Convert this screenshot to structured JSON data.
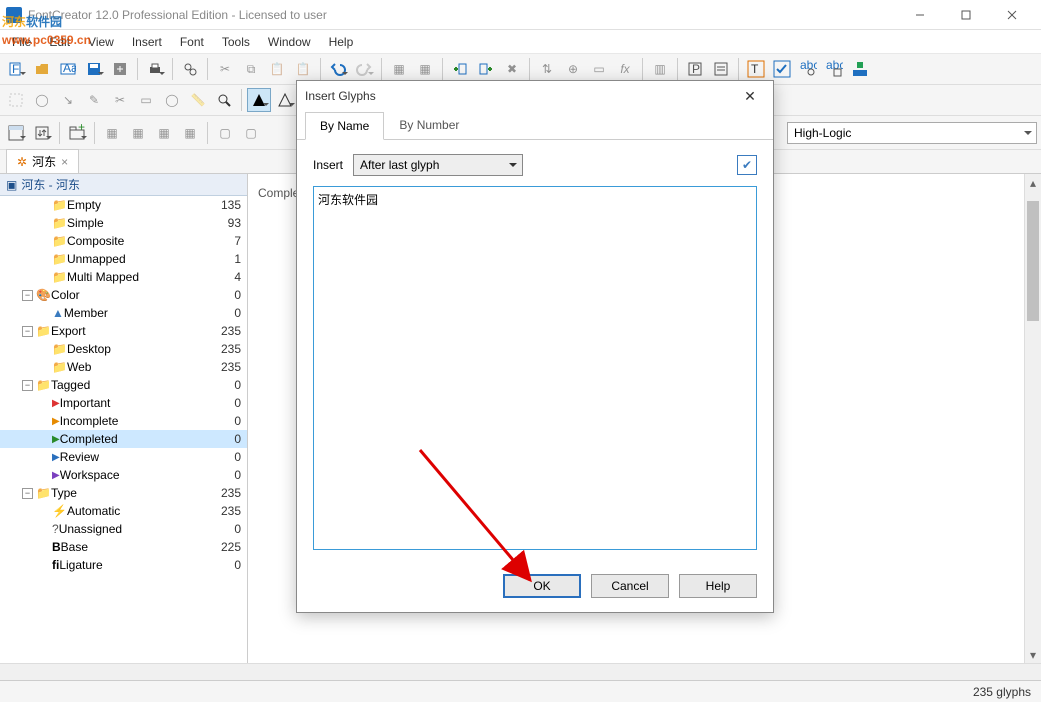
{
  "window": {
    "title": "FontCreator 12.0 Professional Edition - Licensed to user"
  },
  "menu": [
    "File",
    "Edit",
    "View",
    "Insert",
    "Font",
    "Tools",
    "Window",
    "Help"
  ],
  "search_row": {
    "combo1": "",
    "right_field": "High-Logic"
  },
  "doc_tab": {
    "label": "河东",
    "closable": true
  },
  "panel": {
    "title": "河东 - 河东"
  },
  "tree": [
    {
      "depth": 2,
      "icon": "folder",
      "label": "Empty",
      "count": 135
    },
    {
      "depth": 2,
      "icon": "folder",
      "label": "Simple",
      "count": 93
    },
    {
      "depth": 2,
      "icon": "folder",
      "label": "Composite",
      "count": 7
    },
    {
      "depth": 2,
      "icon": "folder",
      "label": "Unmapped",
      "count": 1
    },
    {
      "depth": 2,
      "icon": "folder",
      "label": "Multi Mapped",
      "count": 4
    },
    {
      "depth": 1,
      "exp": "-",
      "icon": "color",
      "label": "Color",
      "count": 0
    },
    {
      "depth": 2,
      "icon": "tri",
      "label": "Member",
      "count": 0
    },
    {
      "depth": 1,
      "exp": "-",
      "icon": "folder",
      "label": "Export",
      "count": 235
    },
    {
      "depth": 2,
      "icon": "folder",
      "label": "Desktop",
      "count": 235
    },
    {
      "depth": 2,
      "icon": "folder",
      "label": "Web",
      "count": 235
    },
    {
      "depth": 1,
      "exp": "-",
      "icon": "folder",
      "label": "Tagged",
      "count": 0
    },
    {
      "depth": 2,
      "icon": "flag-red",
      "label": "Important",
      "count": 0
    },
    {
      "depth": 2,
      "icon": "flag-orange",
      "label": "Incomplete",
      "count": 0
    },
    {
      "depth": 2,
      "icon": "flag-green",
      "label": "Completed",
      "count": 0,
      "selected": true
    },
    {
      "depth": 2,
      "icon": "flag-blue",
      "label": "Review",
      "count": 0
    },
    {
      "depth": 2,
      "icon": "flag-purple",
      "label": "Workspace",
      "count": 0
    },
    {
      "depth": 1,
      "exp": "-",
      "icon": "folder",
      "label": "Type",
      "count": 235
    },
    {
      "depth": 2,
      "icon": "auto",
      "label": "Automatic",
      "count": 235
    },
    {
      "depth": 2,
      "icon": "q",
      "label": "Unassigned",
      "count": 0
    },
    {
      "depth": 2,
      "icon": "B",
      "label": "Base",
      "count": 225
    },
    {
      "depth": 2,
      "icon": "fi",
      "label": "Ligature",
      "count": 0
    }
  ],
  "grid_header": "Complete",
  "statusbar": {
    "glyphs": "235 glyphs"
  },
  "dialog": {
    "title": "Insert Glyphs",
    "tabs": [
      "By Name",
      "By Number"
    ],
    "active_tab": 0,
    "insert_label": "Insert",
    "insert_mode": "After last glyph",
    "text": "河东软件园",
    "buttons": {
      "ok": "OK",
      "cancel": "Cancel",
      "help": "Help"
    }
  },
  "watermark": {
    "line1_a": "河东",
    "line1_b": "软件园",
    "url": "www.pc0359.cn"
  }
}
